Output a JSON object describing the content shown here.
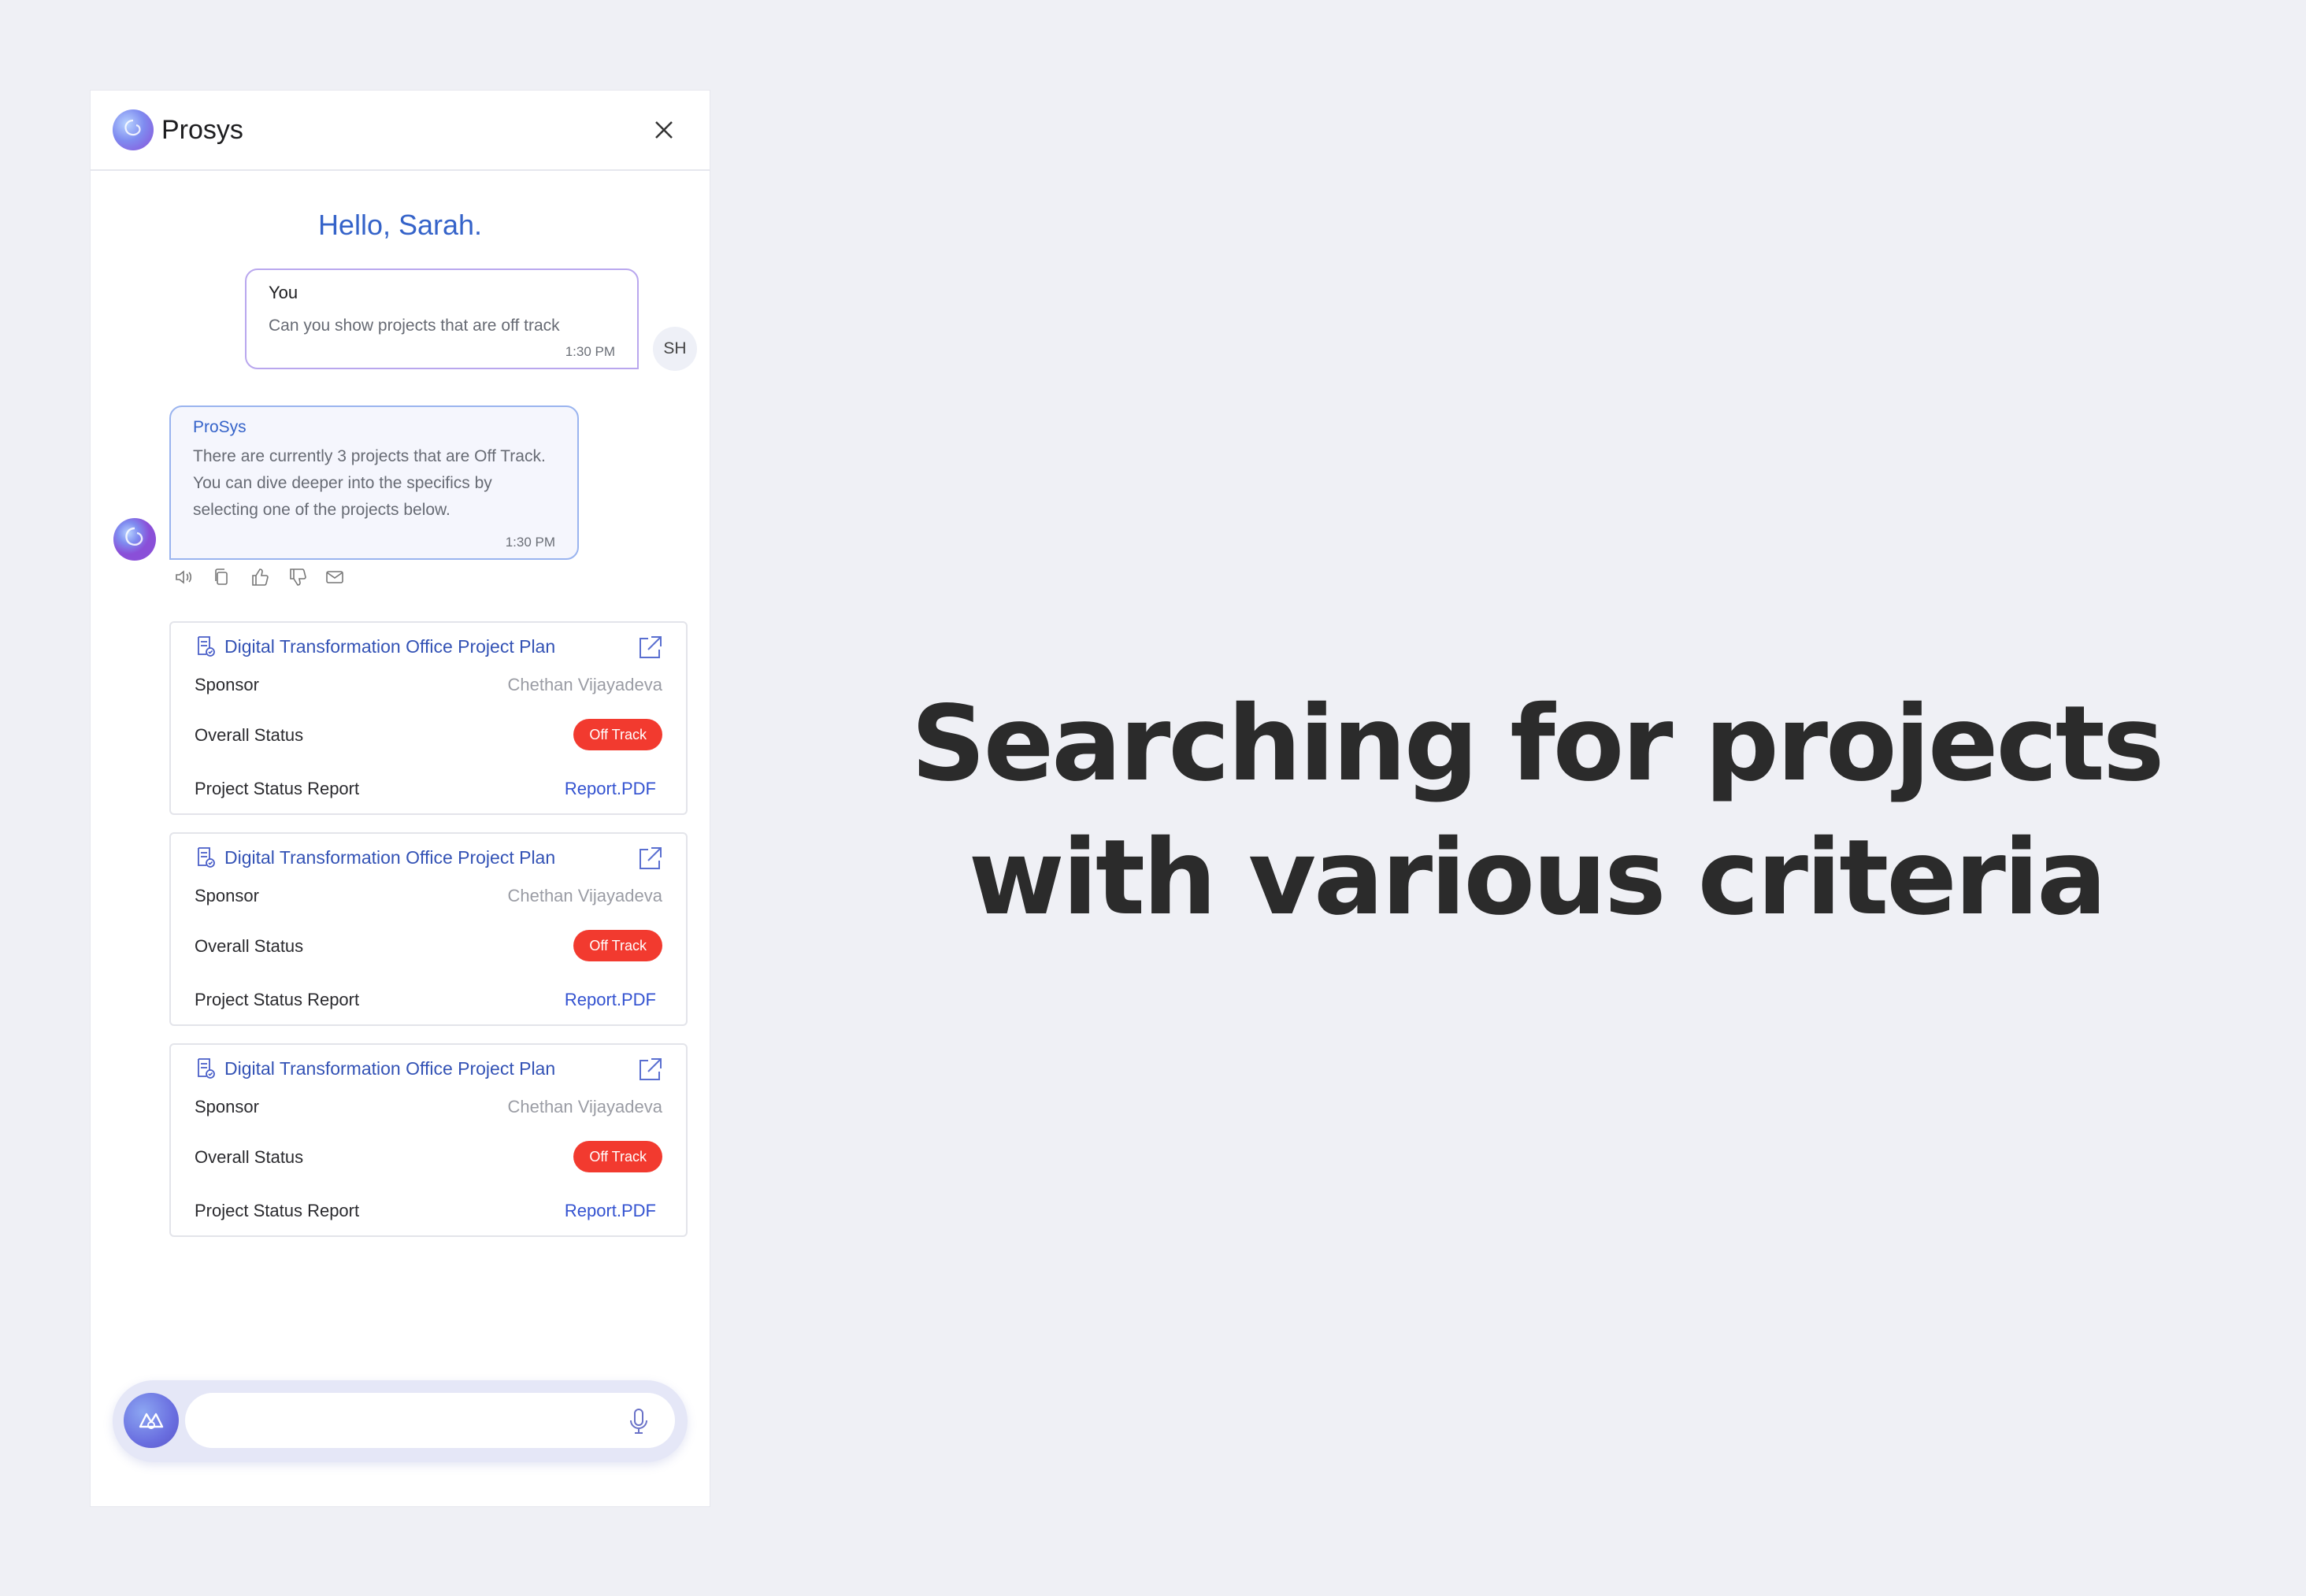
{
  "header": {
    "app_title": "Prosys"
  },
  "greeting": "Hello, Sarah.",
  "user_message": {
    "sender": "You",
    "text": "Can you show projects that are off track",
    "time": "1:30 PM",
    "avatar_initials": "SH"
  },
  "bot_message": {
    "sender": "ProSys",
    "text": "There are currently 3 projects that are Off Track. You can dive deeper into the specifics by selecting one of the projects below.",
    "time": "1:30 PM"
  },
  "message_actions": [
    "speaker-icon",
    "copy-icon",
    "thumbs-up-icon",
    "thumbs-down-icon",
    "mail-icon"
  ],
  "projects": [
    {
      "title": "Digital Transformation Office Project Plan",
      "sponsor_label": "Sponsor",
      "sponsor": "Chethan Vijayadeva",
      "status_label": "Overall Status",
      "status": "Off Track",
      "report_label": "Project Status Report",
      "report": "Report.PDF"
    },
    {
      "title": "Digital Transformation Office Project Plan",
      "sponsor_label": "Sponsor",
      "sponsor": "Chethan Vijayadeva",
      "status_label": "Overall Status",
      "status": "Off Track",
      "report_label": "Project Status Report",
      "report": "Report.PDF"
    },
    {
      "title": "Digital Transformation Office Project Plan",
      "sponsor_label": "Sponsor",
      "sponsor": "Chethan Vijayadeva",
      "status_label": "Overall Status",
      "status": "Off Track",
      "report_label": "Project Status Report",
      "report": "Report.PDF"
    }
  ],
  "composer": {
    "placeholder": ""
  },
  "headline": {
    "line1": "Searching for projects",
    "line2": "with various criteria"
  },
  "colors": {
    "accent": "#3563c9",
    "off_track": "#f23a2f",
    "background": "#eff0f5"
  }
}
